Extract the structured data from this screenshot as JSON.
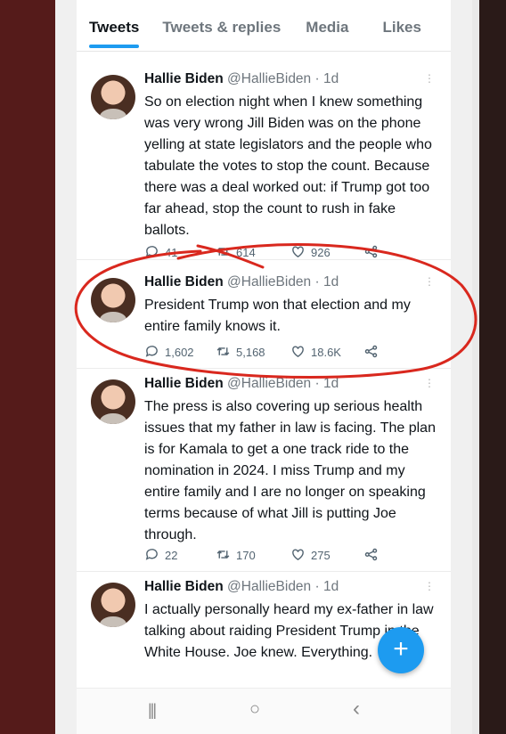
{
  "tabs": [
    "Tweets",
    "Tweets & replies",
    "Media",
    "Likes"
  ],
  "tweets": [
    {
      "name": "Hallie Biden",
      "handle": "@HallieBiden",
      "time": "· 1d",
      "text": "So on election night when I knew something was very wrong Jill Biden was on the phone yelling at state legislators and the people who tabulate the votes to stop the count. Because there was a deal worked out: if Trump got too far ahead, stop the count to rush in fake ballots.",
      "replies": "41",
      "retweets": "614",
      "likes": "926"
    },
    {
      "name": "Hallie Biden",
      "handle": "@HallieBiden",
      "time": "· 1d",
      "text": "President Trump won that election and my entire family knows it.",
      "replies": "1,602",
      "retweets": "5,168",
      "likes": "18.6K"
    },
    {
      "name": "Hallie Biden",
      "handle": "@HallieBiden",
      "time": "· 1d",
      "text": "The press is also covering up serious health issues that my father in law is facing. The plan is for Kamala to get a one track ride to the nomination in 2024. I miss Trump and my entire family and I are no longer on speaking terms because of what Jill is putting Joe through.",
      "replies": "22",
      "retweets": "170",
      "likes": "275"
    },
    {
      "name": "Hallie Biden",
      "handle": "@HallieBiden",
      "time": "· 1d",
      "text": "I actually personally heard my ex-father in law talking about raiding President Trump in the White House. Joe knew. Everything.",
      "replies": "",
      "retweets": "",
      "likes": ""
    }
  ],
  "fab_label": "+",
  "nav": {
    "recents": "|||",
    "home": "○",
    "back": "‹"
  },
  "icons": [
    "more-icon",
    "reply-icon",
    "retweet-icon",
    "like-icon",
    "share-icon",
    "compose-icon"
  ],
  "colors": {
    "accent": "#1d9bf0",
    "annotation": "#d9281e"
  }
}
